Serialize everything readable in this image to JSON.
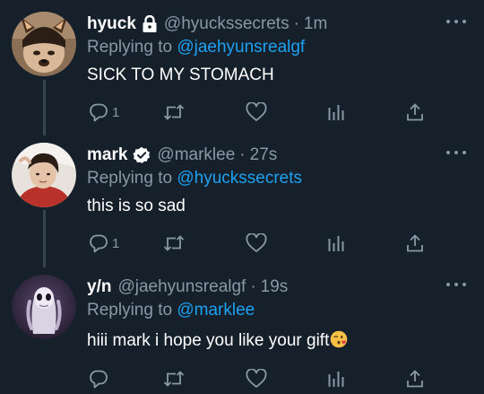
{
  "tweets": [
    {
      "name": "hyuck",
      "badge": "lock-icon",
      "handle": "@hyuckssecrets",
      "separator": "·",
      "time": "1m",
      "replying_prefix": "Replying to",
      "replying_to": "@jaehyunsrealgf",
      "text": "SICK TO MY STOMACH",
      "reply_count": "1"
    },
    {
      "name": "mark",
      "badge": "verified-icon",
      "handle": "@marklee",
      "separator": "·",
      "time": "27s",
      "replying_prefix": "Replying to",
      "replying_to": "@hyuckssecrets",
      "text": "this is so sad",
      "reply_count": "1"
    },
    {
      "name": "y/n",
      "handle": "@jaehyunsrealgf",
      "separator": "·",
      "time": "19s",
      "replying_prefix": "Replying to",
      "replying_to": "@marklee",
      "text": "hiii mark i hope you like your gift",
      "emoji": "face-blowing-a-kiss",
      "reply_count": ""
    }
  ],
  "colors": {
    "background": "#15202b",
    "text": "#ffffff",
    "secondary": "#8899a6",
    "link": "#1da1f2",
    "thread_line": "#38444d"
  }
}
